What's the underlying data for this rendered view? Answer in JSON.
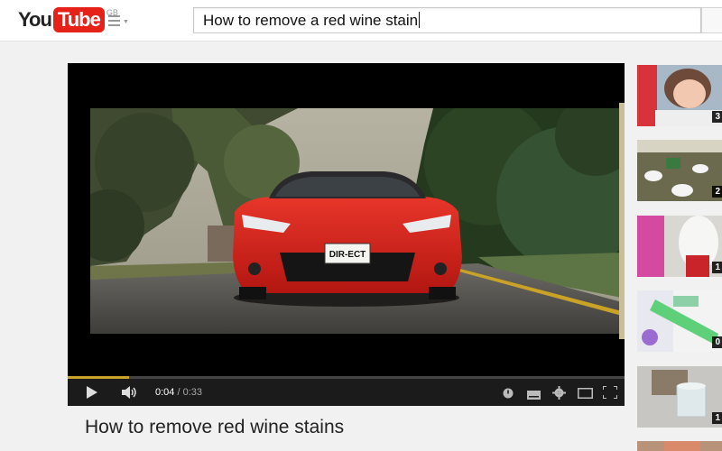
{
  "masthead": {
    "logo_you": "You",
    "logo_tube": "Tube",
    "region": "GB",
    "search_value": "How to remove a red wine stain"
  },
  "player": {
    "licence_plate": "DIR-ECT",
    "current_time": "0:04",
    "separator": "/",
    "duration": "0:33",
    "progress_fraction": 0.11,
    "icons": [
      "play-icon",
      "volume-icon",
      "annotations-icon",
      "captions-icon",
      "settings-icon",
      "theater-mode-icon",
      "fullscreen-icon"
    ]
  },
  "video": {
    "title": "How to remove red wine stains"
  },
  "sidebar": {
    "items": [
      {
        "badge": "3"
      },
      {
        "badge": "2"
      },
      {
        "badge": "1"
      },
      {
        "badge": "0"
      },
      {
        "badge": "1"
      },
      {
        "badge": ""
      }
    ]
  },
  "colors": {
    "brand_red": "#e62117",
    "car_red": "#e0241e",
    "progress": "#c9a227"
  }
}
